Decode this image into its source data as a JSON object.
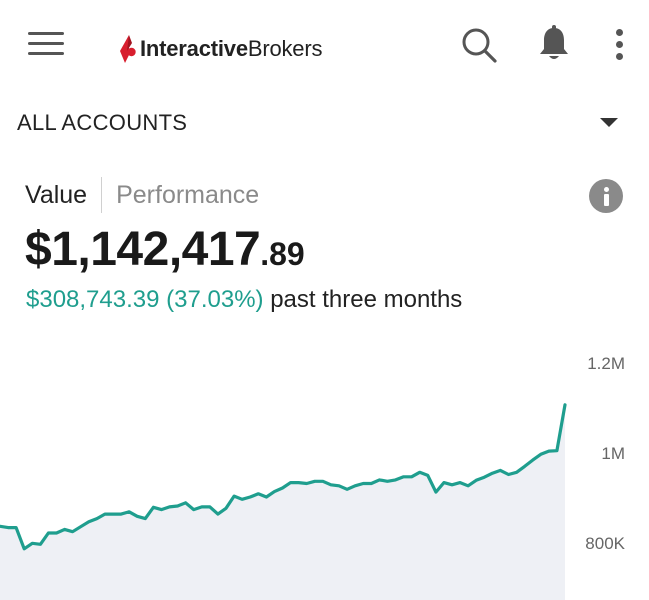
{
  "header": {
    "logo_bold": "Interactive",
    "logo_regular": "Brokers",
    "icons": [
      "menu-icon",
      "search-icon",
      "bell-icon",
      "more-vertical-icon"
    ]
  },
  "account_selector": {
    "label": "ALL ACCOUNTS",
    "icon": "caret-down-icon"
  },
  "tabs": [
    {
      "label": "Value",
      "active": true
    },
    {
      "label": "Performance",
      "active": false
    }
  ],
  "info_icon": "info-icon",
  "balance": {
    "whole": "$1,142,417",
    "decimal": ".89"
  },
  "change": {
    "amount": "$308,743.39",
    "percent": "(37.03%)",
    "period": "past three months"
  },
  "colors": {
    "accent_green": "#1f9e8e",
    "brand_red": "#d81e2e",
    "area_fill": "#eef0f5"
  },
  "chart_data": {
    "type": "area",
    "yticks": [
      "1.2M",
      "1M",
      "800K"
    ],
    "ytick_values": [
      1200000,
      1000000,
      800000
    ],
    "ylim": [
      760000,
      1240000
    ],
    "values": [
      835000,
      832000,
      832000,
      785000,
      797000,
      795000,
      820000,
      820000,
      828000,
      823000,
      834000,
      845000,
      852000,
      862000,
      862000,
      862000,
      867000,
      857000,
      852000,
      877000,
      872000,
      878000,
      880000,
      887000,
      872000,
      878000,
      878000,
      862000,
      875000,
      902000,
      895000,
      900000,
      907000,
      900000,
      912000,
      920000,
      932000,
      932000,
      930000,
      935000,
      935000,
      927000,
      925000,
      917000,
      925000,
      930000,
      930000,
      938000,
      935000,
      938000,
      945000,
      945000,
      955000,
      948000,
      911000,
      932000,
      927000,
      932000,
      925000,
      937000,
      944000,
      953000,
      959000,
      950000,
      955000,
      968000,
      982000,
      995000,
      1002000,
      1003000,
      1105000
    ]
  }
}
